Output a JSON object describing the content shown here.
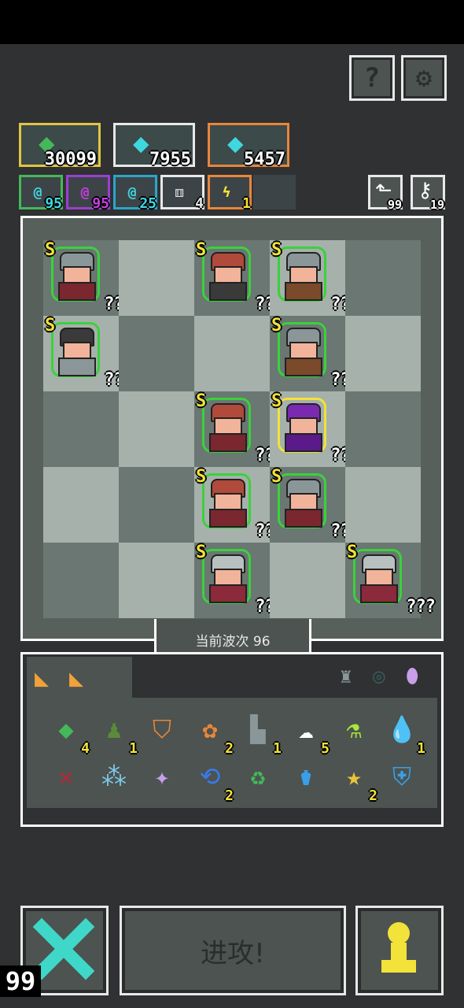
{
  "top_buttons": {
    "help_label": "?",
    "settings_label": "⚙"
  },
  "hero_cards": [
    {
      "value": "30099",
      "border": "#e3c443",
      "gem_color": "#44b85a"
    },
    {
      "value": "7955",
      "border": "#e8e8e8",
      "gem_color": "#3fd7e0"
    },
    {
      "value": "5457",
      "border": "#e8863a",
      "gem_color": "#3fd7e0"
    }
  ],
  "resources": [
    {
      "value": "95",
      "icon": "cyan-spiral-icon",
      "glyph": "@",
      "border": "#44b85a",
      "color": "#3fd7e0"
    },
    {
      "value": "95",
      "icon": "purple-spiral-icon",
      "glyph": "@",
      "border": "#9b3fd0",
      "color": "#c43fe0"
    },
    {
      "value": "25",
      "icon": "blue-spiral-icon",
      "glyph": "@",
      "border": "#2aa6c8",
      "color": "#3fd7e0"
    },
    {
      "value": "4",
      "icon": "dice-icon",
      "glyph": "⚅",
      "border": "#e8e8e8",
      "color": "#e8e8e8"
    },
    {
      "value": "1",
      "icon": "lightning-icon",
      "glyph": "ϟ",
      "border": "#e8863a",
      "color": "#f2e23a"
    }
  ],
  "counters": [
    {
      "icon": "return-arrow-icon",
      "glyph": "⬑",
      "value": "99"
    },
    {
      "icon": "key-icon",
      "glyph": "⚷",
      "value": "19"
    }
  ],
  "board": {
    "units": [
      {
        "row": 0,
        "col": 0,
        "rank": "S",
        "label": "???",
        "helmet": "#8a9697",
        "body": "#7a2730",
        "ring": "#3ad23a"
      },
      {
        "row": 0,
        "col": 2,
        "rank": "S",
        "label": "???",
        "helmet": "#b04a3a",
        "body": "#3a3a3a",
        "ring": "#3ad23a"
      },
      {
        "row": 0,
        "col": 3,
        "rank": "S",
        "label": "???",
        "helmet": "#8a9697",
        "body": "#7a4a2a",
        "ring": "#3ad23a"
      },
      {
        "row": 1,
        "col": 0,
        "rank": "S",
        "label": "???",
        "helmet": "#3a3a3a",
        "body": "#8a9697",
        "ring": "#3ad23a"
      },
      {
        "row": 1,
        "col": 3,
        "rank": "S",
        "label": "???",
        "helmet": "#8a9697",
        "body": "#7a4a2a",
        "ring": "#3ad23a"
      },
      {
        "row": 2,
        "col": 2,
        "rank": "S",
        "label": "???",
        "helmet": "#b04a3a",
        "body": "#7a2730",
        "ring": "#3ad23a"
      },
      {
        "row": 2,
        "col": 3,
        "rank": "S",
        "label": "???",
        "helmet": "#7a2ab0",
        "body": "#5a1a8a",
        "ring": "#f2e23a"
      },
      {
        "row": 3,
        "col": 2,
        "rank": "S",
        "label": "???",
        "helmet": "#b04a3a",
        "body": "#7a2730",
        "ring": "#3ad23a"
      },
      {
        "row": 3,
        "col": 3,
        "rank": "S",
        "label": "???",
        "helmet": "#8a9697",
        "body": "#7a2730",
        "ring": "#3ad23a"
      },
      {
        "row": 4,
        "col": 2,
        "rank": "S",
        "label": "???",
        "helmet": "#b8c0c0",
        "body": "#8a2a3a",
        "ring": "#3ad23a"
      },
      {
        "row": 4,
        "col": 4,
        "rank": "S",
        "label": "???",
        "helmet": "#b8c0c0",
        "body": "#8a2a3a",
        "ring": "#3ad23a"
      }
    ],
    "wave_label": "当前波次 96"
  },
  "inventory": {
    "tabs": [
      {
        "icon": "triangle-tab-icon"
      },
      {
        "icon": "triangle-tab-icon"
      }
    ],
    "filters": [
      {
        "icon": "armor-filter-icon",
        "glyph": "♜"
      },
      {
        "icon": "ring-filter-icon",
        "glyph": "◎"
      },
      {
        "icon": "egg-filter-icon",
        "glyph": "⬮"
      }
    ],
    "items": [
      {
        "icon": "green-gem-icon",
        "glyph": "◆",
        "color": "#44b85a",
        "count": "4"
      },
      {
        "icon": "green-soldier-icon",
        "glyph": "♟",
        "color": "#5a8a3a",
        "count": "1"
      },
      {
        "icon": "orange-shield-icon",
        "glyph": "⛉",
        "color": "#e8863a",
        "count": ""
      },
      {
        "icon": "fox-icon",
        "glyph": "✿",
        "color": "#e8863a",
        "count": "2"
      },
      {
        "icon": "gun-icon",
        "glyph": "▙",
        "color": "#8a9697",
        "count": "1"
      },
      {
        "icon": "cloud-icon",
        "glyph": "☁",
        "color": "#ffffff",
        "count": "5"
      },
      {
        "icon": "potion-icon",
        "glyph": "⚗",
        "color": "#a8e83a",
        "count": ""
      },
      {
        "icon": "water-drop-icon",
        "glyph": "💧",
        "color": "#3a9ee8",
        "count": "1"
      },
      {
        "icon": "dna-icon",
        "glyph": "✕",
        "color": "#b02a3a",
        "count": ""
      },
      {
        "icon": "molecule-icon",
        "glyph": "⁂",
        "color": "#7ec8e8",
        "count": ""
      },
      {
        "icon": "sparkle-icon",
        "glyph": "✦",
        "color": "#c89ee8",
        "count": ""
      },
      {
        "icon": "boomerang-icon",
        "glyph": "⟲",
        "color": "#3a7ae8",
        "count": "2"
      },
      {
        "icon": "recycle-bin-icon",
        "glyph": "♻",
        "color": "#44b85a",
        "count": ""
      },
      {
        "icon": "flask-icon",
        "glyph": "⚱",
        "color": "#3a9ee8",
        "count": ""
      },
      {
        "icon": "star-icon",
        "glyph": "★",
        "color": "#e8c43a",
        "count": "2"
      },
      {
        "icon": "armor-icon",
        "glyph": "⛨",
        "color": "#3a9ee8",
        "count": ""
      }
    ]
  },
  "bottom": {
    "attack_label": "进攻!",
    "counter": "99"
  }
}
